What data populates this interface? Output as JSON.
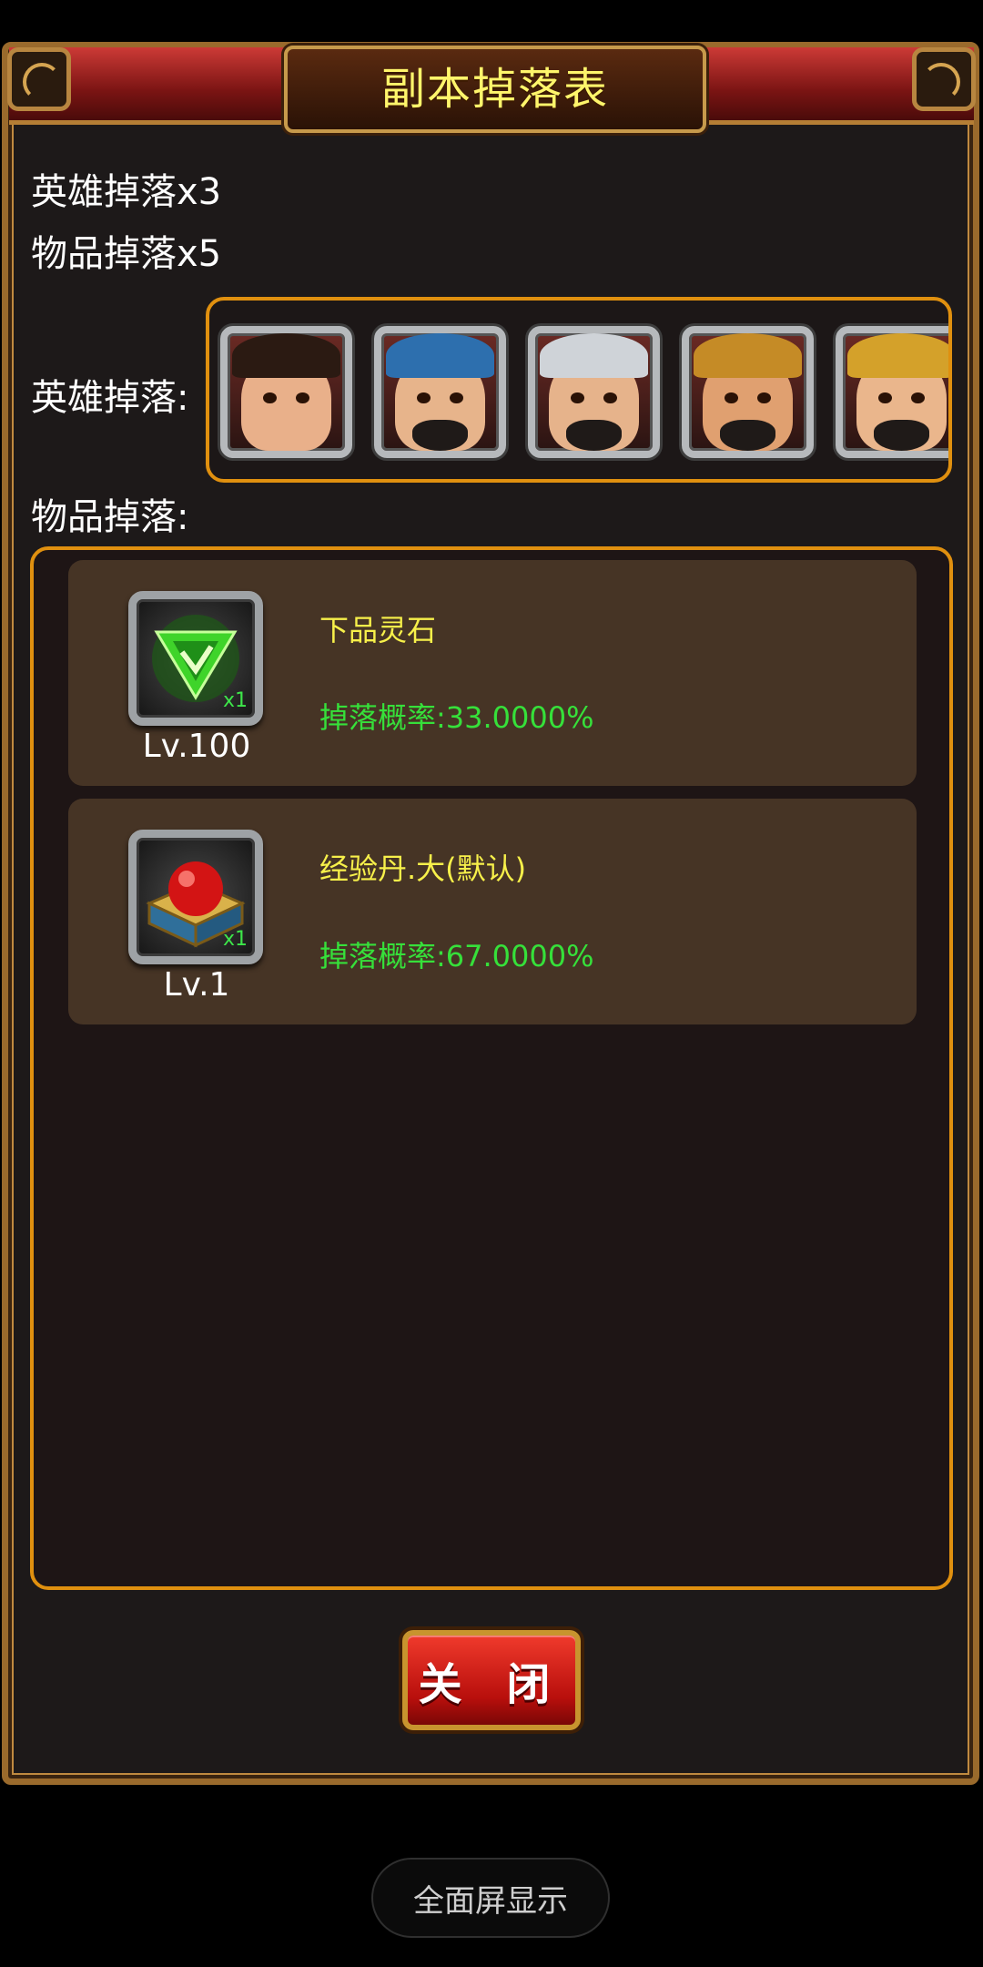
{
  "dialog": {
    "title": "副本掉落表",
    "hero_drop_count": "英雄掉落x3",
    "item_drop_count": "物品掉落x5",
    "hero_drop_label": "英雄掉落:",
    "item_drop_label": "物品掉落:",
    "heroes": [
      {
        "name": "female-hero-portrait",
        "hair": "#2b1a12",
        "accent": "#e9b08a"
      },
      {
        "name": "blue-hat-hero-portrait",
        "hair": "#2d6fae",
        "accent": "#e7b48b"
      },
      {
        "name": "silver-helmet-hero-portrait",
        "hair": "#cfd3d8",
        "accent": "#e6b38b"
      },
      {
        "name": "gold-helmet-eyepatch-hero-portrait",
        "hair": "#c58b26",
        "accent": "#e0a070"
      },
      {
        "name": "gold-helmet-hero-portrait",
        "hair": "#d4a12a",
        "accent": "#eab68c"
      }
    ],
    "items": [
      {
        "icon": "green-spirit-stone-icon",
        "qty": "x1",
        "level": "Lv.100",
        "name": "下品灵石",
        "rate": "掉落概率:33.0000%"
      },
      {
        "icon": "red-orb-chest-icon",
        "qty": "x1",
        "level": "Lv.1",
        "name": "经验丹.大(默认)",
        "rate": "掉落概率:67.0000%"
      }
    ],
    "close_label": "关 闭"
  },
  "system": {
    "fullscreen_label": "全面屏显示"
  },
  "colors": {
    "accent_orange": "#e0900f",
    "title_yellow": "#fff56b",
    "item_name_yellow": "#f7f04a",
    "rate_green": "#36e03a"
  }
}
